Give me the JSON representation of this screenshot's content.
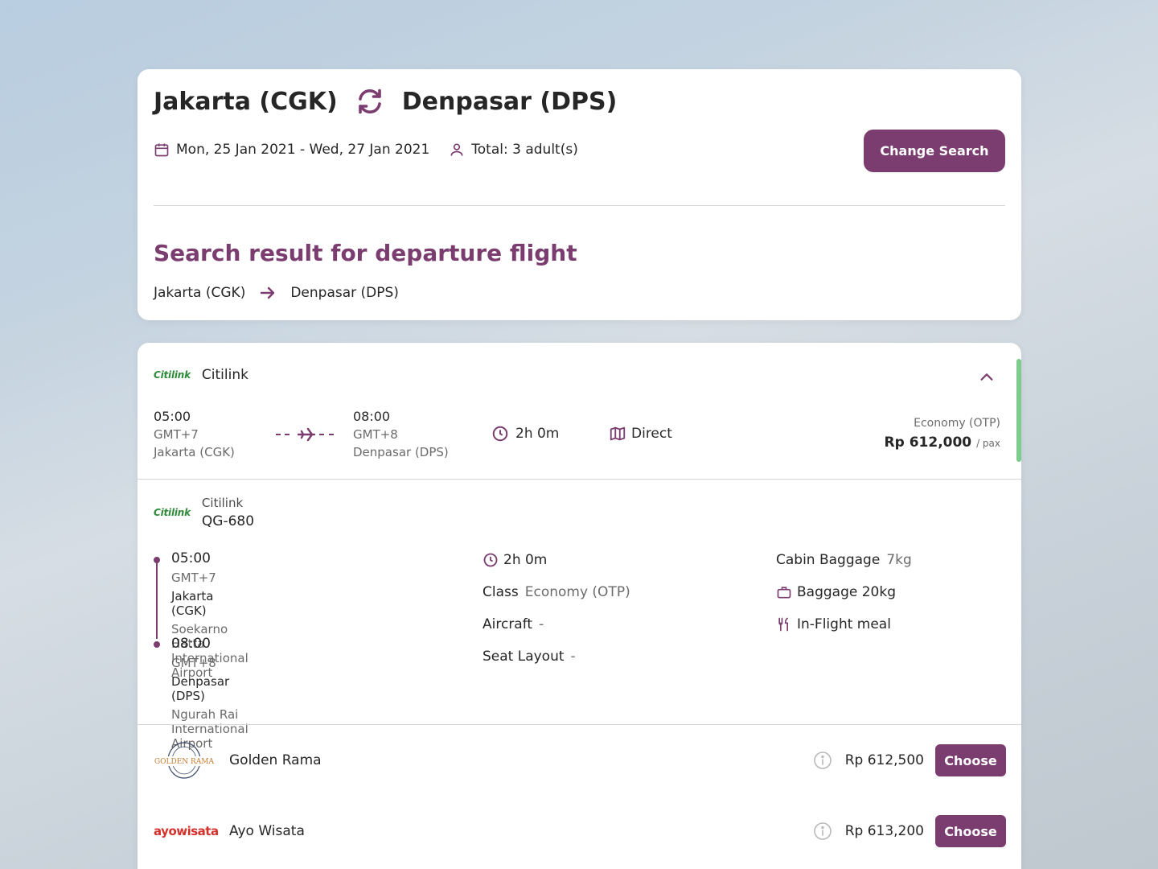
{
  "search": {
    "origin": "Jakarta (CGK)",
    "destination": "Denpasar (DPS)",
    "dates": "Mon, 25 Jan 2021 - Wed, 27 Jan 2021",
    "passengers": "Total: 3 adult(s)",
    "change_label": "Change Search",
    "result_title": "Search result for departure flight",
    "result_origin": "Jakarta (CGK)",
    "result_destination": "Denpasar (DPS)"
  },
  "flight": {
    "airline_logo": "Citilink",
    "airline": "Citilink",
    "depart_time": "05:00",
    "depart_tz": "GMT+7",
    "depart_city": "Jakarta (CGK)",
    "arrive_time": "08:00",
    "arrive_tz": "GMT+8",
    "arrive_city": "Denpasar (DPS)",
    "duration": "2h 0m",
    "stops": "Direct",
    "class": "Economy (OTP)",
    "price": "Rp 612,000",
    "per": "/ pax",
    "accent_color": "#7dcc8b"
  },
  "detail": {
    "airline": "Citilink",
    "flight_no": "QG-680",
    "depart_time": "05:00",
    "depart_tz": "GMT+7",
    "depart_city": "Jakarta (CGK)",
    "depart_airport": "Soekarno Hatta International Airport",
    "arrive_time": "08:00",
    "arrive_tz": "GMT+8",
    "arrive_city": "Denpasar (DPS)",
    "arrive_airport": "Ngurah Rai International Airport",
    "duration": "2h 0m",
    "class_label": "Class",
    "class_value": "Economy (OTP)",
    "aircraft_label": "Aircraft",
    "aircraft_value": "-",
    "seat_label": "Seat Layout",
    "seat_value": "-",
    "cabin_label": "Cabin Baggage",
    "cabin_value": "7kg",
    "baggage": "Baggage 20kg",
    "meal": "In-Flight meal"
  },
  "agents": [
    {
      "logo_text": "GOLDEN RAMA",
      "name": "Golden Rama",
      "price": "Rp 612,500",
      "choose": "Choose"
    },
    {
      "logo_text": "ayowisata",
      "name": "Ayo Wisata",
      "price": "Rp 613,200",
      "choose": "Choose"
    }
  ],
  "colors": {
    "brand": "#7b3d6f",
    "citilink": "#2e8b3a"
  }
}
